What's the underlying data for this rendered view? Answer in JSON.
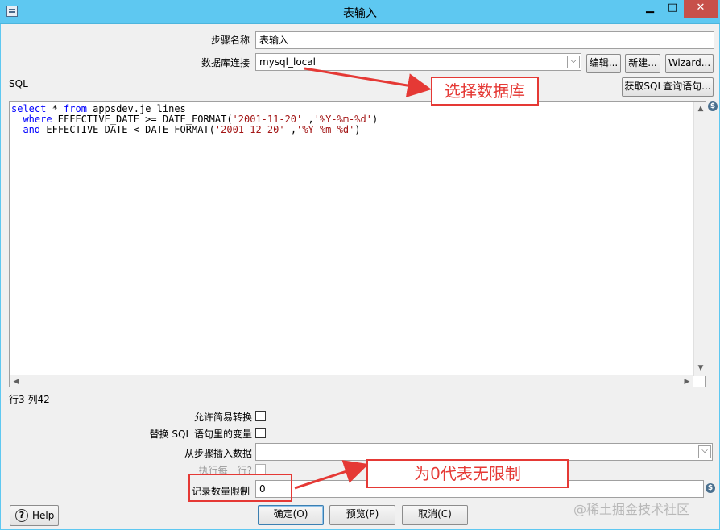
{
  "window": {
    "title": "表输入",
    "min_glyph": "▁",
    "max_glyph": "□",
    "close_glyph": "✕"
  },
  "form": {
    "step_name_label": "步骤名称",
    "step_name_value": "表输入",
    "db_conn_label": "数据库连接",
    "db_conn_value": "mysql_local",
    "edit_button": "编辑...",
    "new_button": "新建...",
    "wizard_button": "Wizard...",
    "sql_label": "SQL",
    "get_sql_button": "获取SQL查询语句...",
    "position_text": "行3 列42"
  },
  "sql": {
    "line1": [
      {
        "t": "select",
        "k": "kw"
      },
      {
        "t": " * ",
        "k": ""
      },
      {
        "t": "from",
        "k": "kw"
      },
      {
        "t": " appsdev.je_lines",
        "k": ""
      }
    ],
    "line2": [
      {
        "t": "  ",
        "k": ""
      },
      {
        "t": "where",
        "k": "kw"
      },
      {
        "t": " EFFECTIVE_DATE >= DATE_FORMAT(",
        "k": ""
      },
      {
        "t": "'2001-11-20'",
        "k": "str"
      },
      {
        "t": " ,",
        "k": ""
      },
      {
        "t": "'%Y-%m-%d'",
        "k": "str"
      },
      {
        "t": ")",
        "k": ""
      }
    ],
    "line3": [
      {
        "t": "  ",
        "k": ""
      },
      {
        "t": "and",
        "k": "kw"
      },
      {
        "t": " EFFECTIVE_DATE < DATE_FORMAT(",
        "k": ""
      },
      {
        "t": "'2001-12-20'",
        "k": "str"
      },
      {
        "t": " ,",
        "k": ""
      },
      {
        "t": "'%Y-%m-%d'",
        "k": "str"
      },
      {
        "t": ")",
        "k": ""
      }
    ]
  },
  "options": {
    "lazy_conversion_label": "允许简易转换",
    "replace_vars_label": "替换 SQL 语句里的变量",
    "insert_from_step_label": "从步骤插入数据",
    "insert_from_step_value": "",
    "execute_each_row_label": "执行每一行?",
    "limit_label": "记录数量限制",
    "limit_value": "0"
  },
  "buttons": {
    "help": "Help",
    "ok": "确定(O)",
    "preview": "预览(P)",
    "cancel": "取消(C)"
  },
  "annotations": {
    "select_db": "选择数据库",
    "zero_means_unlimited": "为0代表无限制"
  },
  "watermark": "@稀土掘金技术社区",
  "icons": {
    "variable": "$",
    "help": "?",
    "chevron_down": "⌵"
  },
  "colors": {
    "titlebar": "#5ec8f1",
    "annotation_red": "#e53935",
    "keyword_blue": "#0000ff",
    "string_red": "#a31515"
  }
}
